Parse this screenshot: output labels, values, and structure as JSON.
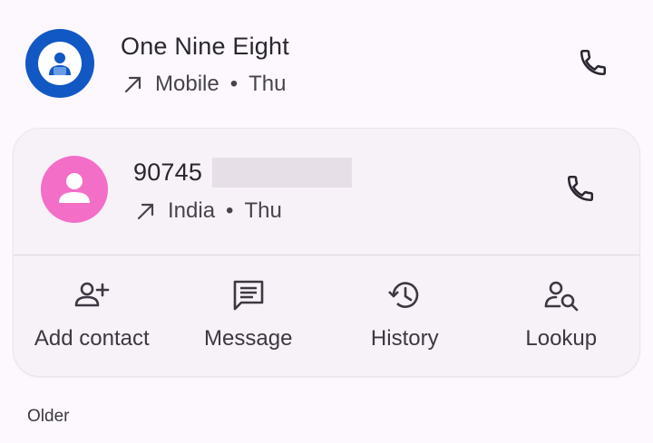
{
  "calls": [
    {
      "name": "One Nine Eight",
      "direction_icon": "outgoing-call-icon",
      "type": "Mobile",
      "separator": "•",
      "day": "Thu",
      "avatar_color": "#1258c4"
    },
    {
      "name": "90745",
      "direction_icon": "outgoing-call-icon",
      "type": "India",
      "separator": "•",
      "day": "Thu",
      "avatar_color": "#f26ec7"
    }
  ],
  "actions": [
    {
      "label": "Add contact",
      "icon": "add-person-icon"
    },
    {
      "label": "Message",
      "icon": "message-icon"
    },
    {
      "label": "History",
      "icon": "history-icon"
    },
    {
      "label": "Lookup",
      "icon": "person-search-icon"
    }
  ],
  "section_header": "Older",
  "colors": {
    "background": "#fdf8fd",
    "card": "#f7f1f8",
    "text": "#2a2630",
    "secondary_text": "#47434c"
  }
}
